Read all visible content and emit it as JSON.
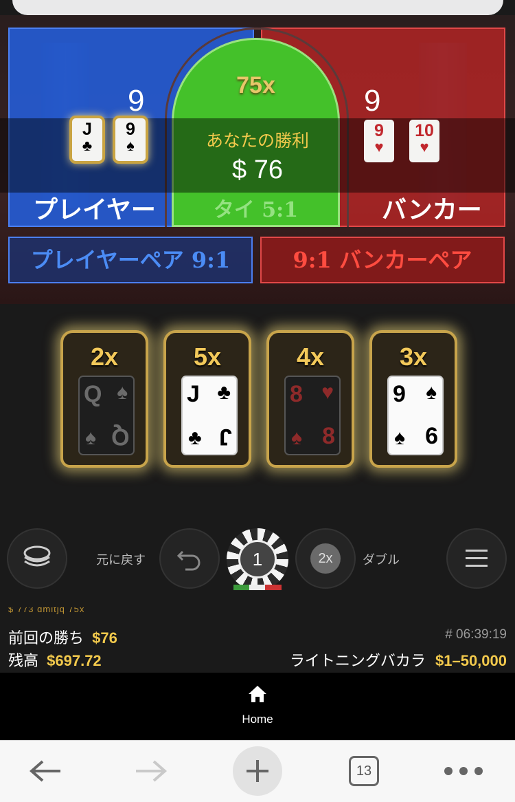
{
  "table": {
    "player": {
      "label": "プレイヤー",
      "score": "9",
      "cards": [
        {
          "rank": "J",
          "suit": "♣"
        },
        {
          "rank": "9",
          "suit": "♠"
        }
      ]
    },
    "banker": {
      "label": "バンカー",
      "score": "9",
      "cards": [
        {
          "rank": "9",
          "suit": "♥"
        },
        {
          "rank": "10",
          "suit": "♥"
        }
      ]
    },
    "tie": {
      "multiplier": "75x",
      "label": "タイ 5:1"
    },
    "win": {
      "title": "あなたの勝利",
      "amount": "$ 76"
    },
    "player_pair": "プレイヤーペア 9:1",
    "banker_pair": "9:1 バンカーペア"
  },
  "lightning_cards": [
    {
      "multiplier": "2x",
      "rank": "Q",
      "suit": "♠",
      "suit_bottom": "♠",
      "style": "dark"
    },
    {
      "multiplier": "5x",
      "rank": "J",
      "suit": "♣",
      "suit_bottom": "♣",
      "style": "light"
    },
    {
      "multiplier": "4x",
      "rank": "8",
      "suit": "♥",
      "suit_bottom": "♠",
      "style": "dark-red"
    },
    {
      "multiplier": "3x",
      "rank": "9",
      "suit": "♠",
      "suit_bottom": "♠",
      "rank_bottom": "6",
      "style": "light"
    }
  ],
  "controls": {
    "undo_label": "元に戻す",
    "chip_value": "1",
    "double_chip": "2x",
    "double_label": "ダブル"
  },
  "ticker": "$ 773 dmltjq 75x",
  "info": {
    "last_win_label": "前回の勝ち",
    "last_win_value": "$76",
    "balance_label": "残高",
    "balance_value": "$697.72",
    "round_id": "# 06:39:19",
    "game_name": "ライトニングバカラ",
    "limits": "$1–50,000"
  },
  "nav": {
    "home_label": "Home"
  },
  "browser": {
    "tab_count": "13"
  },
  "colors": {
    "player": "#255cd6",
    "banker": "#ad2424",
    "tie": "#44c12a",
    "gold": "#f2c94c"
  }
}
